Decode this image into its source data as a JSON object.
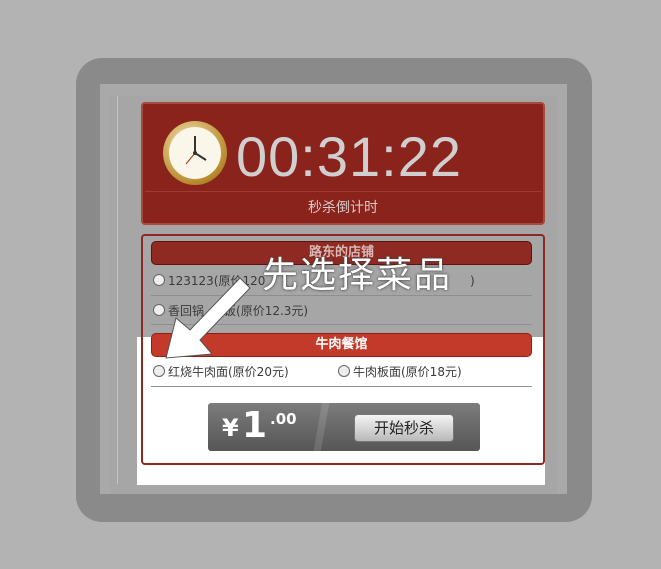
{
  "timer": {
    "countdown": "00:31:22",
    "label": "秒杀倒计时"
  },
  "shops": [
    {
      "name": "路东的店铺",
      "items": [
        {
          "label": "123123(原价120",
          "label_suffix": ")"
        },
        {
          "label": "香回锅",
          "label_suffix": "饭(原价12.3元)"
        }
      ]
    },
    {
      "name": "牛肉餐馆",
      "items": [
        {
          "label": "红烧牛肉面(原价20元)"
        },
        {
          "label": "牛肉板面(原价18元)"
        }
      ]
    }
  ],
  "overlay_annotation": "先选择菜品",
  "price": {
    "symbol": "¥",
    "integer": "1",
    "decimal": ".00"
  },
  "start_button_label": "开始秒杀",
  "icons": {
    "clock": "clock-icon",
    "arrow": "arrow-pointer-icon",
    "radio": "radio-icon"
  },
  "colors": {
    "timer_bg": "#8b231d",
    "header_dark": "#8f2a22",
    "header_red": "#c3392a",
    "background": "#b3b3b3",
    "frame": "#8a8a8a"
  }
}
